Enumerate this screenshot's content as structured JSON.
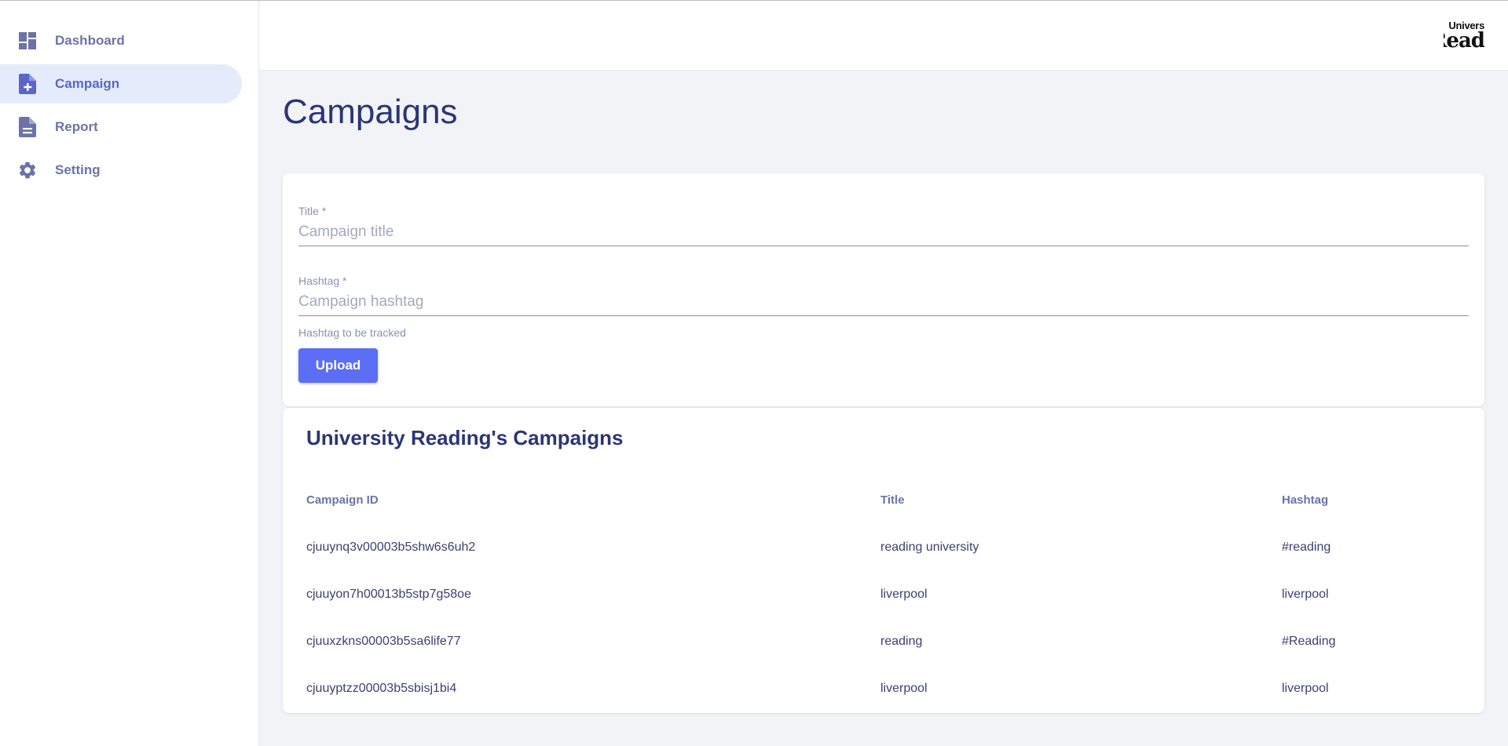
{
  "sidebar": {
    "items": [
      {
        "label": "Dashboard",
        "icon": "dashboard-icon",
        "active": false
      },
      {
        "label": "Campaign",
        "icon": "note-add-icon",
        "active": true
      },
      {
        "label": "Report",
        "icon": "document-icon",
        "active": false
      },
      {
        "label": "Setting",
        "icon": "gear-icon",
        "active": false
      }
    ]
  },
  "header": {
    "logo_line1": "Univers",
    "logo_line2": "Read"
  },
  "main": {
    "title": "Campaigns",
    "form": {
      "title_label": "Title *",
      "title_placeholder": "Campaign title",
      "hashtag_label": "Hashtag *",
      "hashtag_placeholder": "Campaign hashtag",
      "hashtag_helper": "Hashtag to be tracked",
      "upload_label": "Upload"
    },
    "table": {
      "title": "University Reading's Campaigns",
      "headers": [
        "Campaign ID",
        "Title",
        "Hashtag"
      ],
      "rows": [
        [
          "cjuuynq3v00003b5shw6s6uh2",
          "reading university",
          "#reading"
        ],
        [
          "cjuuyon7h00013b5stp7g58oe",
          "liverpool",
          "liverpool"
        ],
        [
          "cjuuxzkns00003b5sa6life77",
          "reading",
          "#Reading"
        ],
        [
          "cjuuyptzz00003b5sbisj1bi4",
          "liverpool",
          "liverpool"
        ]
      ]
    }
  },
  "colors": {
    "accent": "#5b6ef5",
    "nav_text": "#6b73a8",
    "heading": "#2b3674",
    "active_bg": "#e4ecfb",
    "page_bg": "#f2f3f7"
  }
}
